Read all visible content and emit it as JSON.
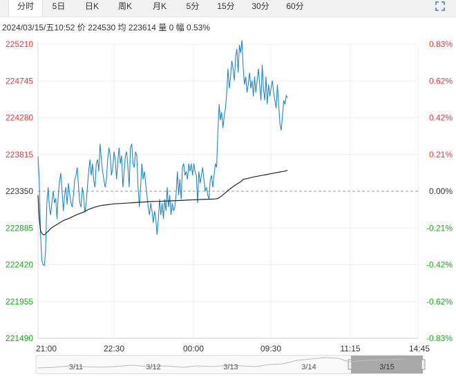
{
  "tabs": [
    {
      "label": "分时",
      "active": true
    },
    {
      "label": "5日",
      "active": false
    },
    {
      "label": "日K",
      "active": false
    },
    {
      "label": "周K",
      "active": false
    },
    {
      "label": "月K",
      "active": false
    },
    {
      "label": "5分",
      "active": false
    },
    {
      "label": "15分",
      "active": false
    },
    {
      "label": "30分",
      "active": false
    },
    {
      "label": "60分",
      "active": false
    }
  ],
  "expand_icon": "expand-icon",
  "info": {
    "date": "2024/03/15/五10:52",
    "price_label": "价",
    "price": "224530",
    "avg_label": "均",
    "avg": "223614",
    "vol_label": "量",
    "vol": "0",
    "range_label": "幅",
    "range": "0.53%"
  },
  "colors": {
    "up": "#e4393c",
    "down": "#1aa81a",
    "price_line": "#1e88c7",
    "avg_line": "#222222",
    "grid": "#eeeeee",
    "ref_line": "#999999"
  },
  "chart_data": {
    "type": "line",
    "ylim": [
      221490,
      225210
    ],
    "prev_close": 223350,
    "y_ticks": [
      {
        "value": 225210,
        "label": "225210",
        "pct": "0.83%"
      },
      {
        "value": 224745,
        "label": "224745",
        "pct": "0.62%"
      },
      {
        "value": 224280,
        "label": "224280",
        "pct": "0.42%"
      },
      {
        "value": 223815,
        "label": "223815",
        "pct": "0.21%"
      },
      {
        "value": 223350,
        "label": "223350",
        "pct": "0.00%"
      },
      {
        "value": 222885,
        "label": "222885",
        "pct": "-0.21%"
      },
      {
        "value": 222420,
        "label": "222420",
        "pct": "-0.42%"
      },
      {
        "value": 221955,
        "label": "221955",
        "pct": "-0.62%"
      },
      {
        "value": 221490,
        "label": "221490",
        "pct": "-0.83%"
      }
    ],
    "x_ticks": [
      "21:00",
      "22:30",
      "00:00",
      "09:30",
      "11:15",
      "14:45"
    ],
    "price": [
      [
        0,
        223790
      ],
      [
        1,
        223500
      ],
      [
        2,
        222800
      ],
      [
        3,
        222480
      ],
      [
        4,
        222420
      ],
      [
        5,
        222410
      ],
      [
        6,
        222600
      ],
      [
        7,
        223200
      ],
      [
        8,
        223400
      ],
      [
        9,
        223150
      ],
      [
        10,
        223050
      ],
      [
        11,
        223220
      ],
      [
        12,
        223350
      ],
      [
        13,
        223200
      ],
      [
        14,
        223260
      ],
      [
        15,
        223000
      ],
      [
        16,
        223300
      ],
      [
        17,
        223480
      ],
      [
        18,
        223580
      ],
      [
        19,
        223350
      ],
      [
        20,
        223100
      ],
      [
        21,
        223300
      ],
      [
        22,
        223400
      ],
      [
        23,
        223180
      ],
      [
        24,
        223450
      ],
      [
        25,
        223320
      ],
      [
        26,
        223200
      ],
      [
        27,
        223150
      ],
      [
        28,
        223300
      ],
      [
        29,
        223500
      ],
      [
        30,
        223550
      ],
      [
        31,
        223650
      ],
      [
        32,
        223400
      ],
      [
        33,
        223200
      ],
      [
        34,
        223150
      ],
      [
        35,
        223400
      ],
      [
        36,
        223300
      ],
      [
        37,
        223080
      ],
      [
        38,
        223200
      ],
      [
        39,
        223400
      ],
      [
        40,
        223600
      ],
      [
        41,
        223750
      ],
      [
        42,
        223550
      ],
      [
        43,
        223700
      ],
      [
        44,
        223480
      ],
      [
        45,
        223400
      ],
      [
        46,
        223700
      ],
      [
        47,
        223750
      ],
      [
        48,
        223600
      ],
      [
        49,
        223950
      ],
      [
        50,
        223750
      ],
      [
        51,
        223600
      ],
      [
        52,
        223500
      ],
      [
        53,
        223400
      ],
      [
        54,
        223500
      ],
      [
        55,
        223750
      ],
      [
        56,
        223900
      ],
      [
        57,
        223800
      ],
      [
        58,
        223550
      ],
      [
        59,
        223650
      ],
      [
        60,
        223850
      ],
      [
        61,
        223750
      ],
      [
        62,
        223500
      ],
      [
        63,
        223720
      ],
      [
        64,
        223900
      ],
      [
        65,
        223700
      ],
      [
        66,
        223800
      ],
      [
        67,
        223400
      ],
      [
        68,
        223600
      ],
      [
        69,
        223800
      ],
      [
        70,
        223850
      ],
      [
        71,
        223650
      ],
      [
        72,
        223400
      ],
      [
        73,
        223900
      ],
      [
        74,
        223950
      ],
      [
        75,
        223700
      ],
      [
        76,
        223650
      ],
      [
        77,
        223850
      ],
      [
        78,
        223800
      ],
      [
        79,
        223400
      ],
      [
        80,
        223150
      ],
      [
        81,
        223400
      ],
      [
        82,
        223700
      ],
      [
        83,
        223500
      ],
      [
        84,
        223600
      ],
      [
        85,
        223450
      ],
      [
        86,
        223300
      ],
      [
        87,
        223150
      ],
      [
        88,
        223050
      ],
      [
        89,
        223200
      ],
      [
        90,
        223100
      ],
      [
        91,
        222950
      ],
      [
        92,
        223100
      ],
      [
        93,
        223000
      ],
      [
        94,
        222800
      ],
      [
        95,
        223000
      ],
      [
        96,
        223250
      ],
      [
        97,
        223050
      ],
      [
        98,
        223200
      ],
      [
        99,
        223000
      ],
      [
        100,
        223250
      ],
      [
        101,
        223100
      ],
      [
        102,
        223400
      ],
      [
        103,
        223150
      ],
      [
        104,
        223300
      ],
      [
        105,
        223050
      ],
      [
        106,
        223200
      ],
      [
        107,
        223100
      ],
      [
        108,
        223150
      ],
      [
        109,
        223300
      ],
      [
        110,
        223600
      ],
      [
        111,
        223300
      ],
      [
        112,
        223500
      ],
      [
        113,
        223250
      ],
      [
        114,
        223650
      ],
      [
        115,
        223700
      ],
      [
        116,
        223550
      ],
      [
        117,
        223600
      ],
      [
        118,
        223500
      ],
      [
        119,
        223700
      ],
      [
        120,
        223600
      ],
      [
        121,
        223700
      ],
      [
        122,
        223550
      ],
      [
        123,
        223700
      ],
      [
        124,
        223600
      ],
      [
        125,
        223550
      ],
      [
        126,
        223200
      ],
      [
        127,
        223600
      ],
      [
        128,
        223450
      ],
      [
        129,
        223550
      ],
      [
        130,
        223650
      ],
      [
        131,
        223500
      ],
      [
        132,
        223350
      ],
      [
        133,
        223400
      ],
      [
        134,
        223300
      ],
      [
        135,
        223250
      ],
      [
        136,
        223500
      ],
      [
        137,
        223550
      ],
      [
        138,
        223400
      ],
      [
        139,
        223550
      ],
      [
        140,
        223700
      ],
      [
        141,
        223650
      ],
      [
        142,
        224100
      ],
      [
        143,
        224450
      ],
      [
        144,
        224250
      ],
      [
        145,
        224350
      ],
      [
        146,
        224150
      ],
      [
        147,
        224300
      ],
      [
        148,
        224400
      ],
      [
        149,
        224600
      ],
      [
        150,
        224900
      ],
      [
        151,
        224650
      ],
      [
        152,
        224800
      ],
      [
        153,
        225000
      ],
      [
        154,
        224900
      ],
      [
        155,
        224750
      ],
      [
        156,
        225050
      ],
      [
        157,
        225150
      ],
      [
        158,
        224850
      ],
      [
        159,
        225200
      ],
      [
        160,
        225100
      ],
      [
        161,
        225260
      ],
      [
        162,
        224900
      ],
      [
        163,
        224700
      ],
      [
        164,
        224800
      ],
      [
        165,
        224600
      ],
      [
        166,
        224700
      ],
      [
        167,
        224850
      ],
      [
        168,
        224650
      ],
      [
        169,
        224750
      ],
      [
        170,
        224550
      ],
      [
        171,
        224800
      ],
      [
        172,
        224600
      ],
      [
        173,
        224750
      ],
      [
        174,
        224900
      ],
      [
        175,
        224700
      ],
      [
        176,
        224500
      ],
      [
        177,
        224950
      ],
      [
        178,
        224650
      ],
      [
        179,
        224500
      ],
      [
        180,
        224800
      ],
      [
        181,
        224450
      ],
      [
        182,
        224700
      ],
      [
        183,
        224550
      ],
      [
        184,
        224650
      ],
      [
        185,
        224750
      ],
      [
        186,
        224600
      ],
      [
        187,
        224500
      ],
      [
        188,
        224400
      ],
      [
        189,
        224700
      ],
      [
        190,
        224450
      ],
      [
        191,
        224200
      ],
      [
        192,
        224120
      ],
      [
        193,
        224300
      ],
      [
        194,
        224500
      ],
      [
        195,
        224450
      ],
      [
        196,
        224560
      ],
      [
        197,
        224530
      ]
    ],
    "avg": [
      [
        0,
        223300
      ],
      [
        1,
        223000
      ],
      [
        2,
        222850
      ],
      [
        3,
        222820
      ],
      [
        4,
        222800
      ],
      [
        5,
        222800
      ],
      [
        6,
        222810
      ],
      [
        7,
        222830
      ],
      [
        8,
        222840
      ],
      [
        9,
        222860
      ],
      [
        10,
        222880
      ],
      [
        12,
        222900
      ],
      [
        15,
        222930
      ],
      [
        18,
        222960
      ],
      [
        20,
        222980
      ],
      [
        25,
        223010
      ],
      [
        30,
        223050
      ],
      [
        35,
        223080
      ],
      [
        40,
        223120
      ],
      [
        45,
        223150
      ],
      [
        50,
        223170
      ],
      [
        55,
        223180
      ],
      [
        60,
        223190
      ],
      [
        65,
        223195
      ],
      [
        70,
        223200
      ],
      [
        75,
        223205
      ],
      [
        80,
        223210
      ],
      [
        85,
        223215
      ],
      [
        90,
        223220
      ],
      [
        95,
        223222
      ],
      [
        100,
        223225
      ],
      [
        105,
        223228
      ],
      [
        110,
        223232
      ],
      [
        115,
        223236
      ],
      [
        120,
        223240
      ],
      [
        125,
        223243
      ],
      [
        130,
        223246
      ],
      [
        135,
        223249
      ],
      [
        140,
        223252
      ],
      [
        142,
        223258
      ],
      [
        145,
        223290
      ],
      [
        150,
        223360
      ],
      [
        155,
        223420
      ],
      [
        160,
        223470
      ],
      [
        162,
        223500
      ],
      [
        165,
        223510
      ],
      [
        170,
        223530
      ],
      [
        175,
        223545
      ],
      [
        180,
        223560
      ],
      [
        185,
        223575
      ],
      [
        190,
        223590
      ],
      [
        195,
        223605
      ],
      [
        197,
        223614
      ]
    ],
    "x_index_max": 300,
    "date_axis": [
      "3/11",
      "3/12",
      "3/13",
      "3/14",
      "3/15"
    ],
    "navigator_selected": "3/15"
  }
}
